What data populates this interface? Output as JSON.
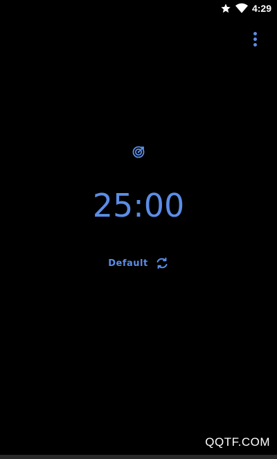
{
  "status_bar": {
    "time": "4:29",
    "icons": [
      "star-icon",
      "wifi-icon"
    ]
  },
  "menu": {
    "icon": "more-vert-icon"
  },
  "timer": {
    "mode_icon": "target-icon",
    "time": "25:00"
  },
  "profile": {
    "label": "Default",
    "reset_icon": "refresh-icon"
  },
  "watermark": {
    "text": "QQTF.COM"
  },
  "colors": {
    "background": "#000000",
    "accent": "#5b8de6",
    "status_text": "#ffffff"
  }
}
